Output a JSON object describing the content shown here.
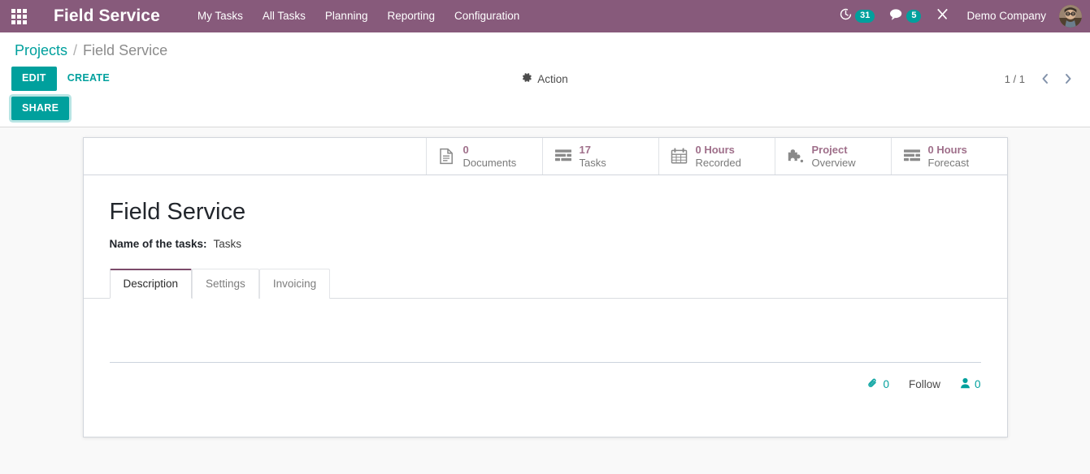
{
  "navbar": {
    "apps_icon": "apps-grid-icon",
    "brand": "Field Service",
    "menu_items": [
      {
        "label": "My Tasks"
      },
      {
        "label": "All Tasks"
      },
      {
        "label": "Planning"
      },
      {
        "label": "Reporting"
      },
      {
        "label": "Configuration"
      }
    ],
    "systray": {
      "activities_icon": "clock-icon",
      "activities_count": "31",
      "messages_icon": "chat-bubble-icon",
      "messages_count": "5",
      "debug_icon": "tools-icon",
      "company": "Demo Company",
      "avatar_icon": "user-avatar"
    },
    "colors": {
      "navbar_bg": "#875A7B",
      "badge_bg": "#00A09D",
      "accent": "#00A09D"
    }
  },
  "control_panel": {
    "breadcrumb": {
      "parent": "Projects",
      "separator": "/",
      "current": "Field Service"
    },
    "edit_label": "EDIT",
    "create_label": "CREATE",
    "action_label": "Action",
    "action_icon": "gear-icon",
    "share_label": "SHARE",
    "pager": {
      "value": "1 / 1",
      "prev_icon": "chevron-left-icon",
      "next_icon": "chevron-right-icon"
    }
  },
  "stat_buttons": [
    {
      "icon": "document-icon",
      "value": "0",
      "label": "Documents"
    },
    {
      "icon": "tasks-list-icon",
      "value": "17",
      "label": "Tasks"
    },
    {
      "icon": "calendar-icon",
      "value": "0 Hours",
      "label": "Recorded"
    },
    {
      "icon": "puzzle-piece-icon",
      "value": "Project",
      "label": "Overview"
    },
    {
      "icon": "forecast-list-icon",
      "value": "0 Hours",
      "label": "Forecast"
    }
  ],
  "record": {
    "title": "Field Service",
    "field_label": "Name of the tasks:",
    "field_value": "Tasks",
    "tabs": [
      {
        "label": "Description",
        "active": true
      },
      {
        "label": "Settings",
        "active": false
      },
      {
        "label": "Invoicing",
        "active": false
      }
    ]
  },
  "chatter": {
    "attachment_icon": "paperclip-icon",
    "attachment_count": "0",
    "follow_label": "Follow",
    "followers_icon": "user-icon",
    "followers_count": "0"
  }
}
